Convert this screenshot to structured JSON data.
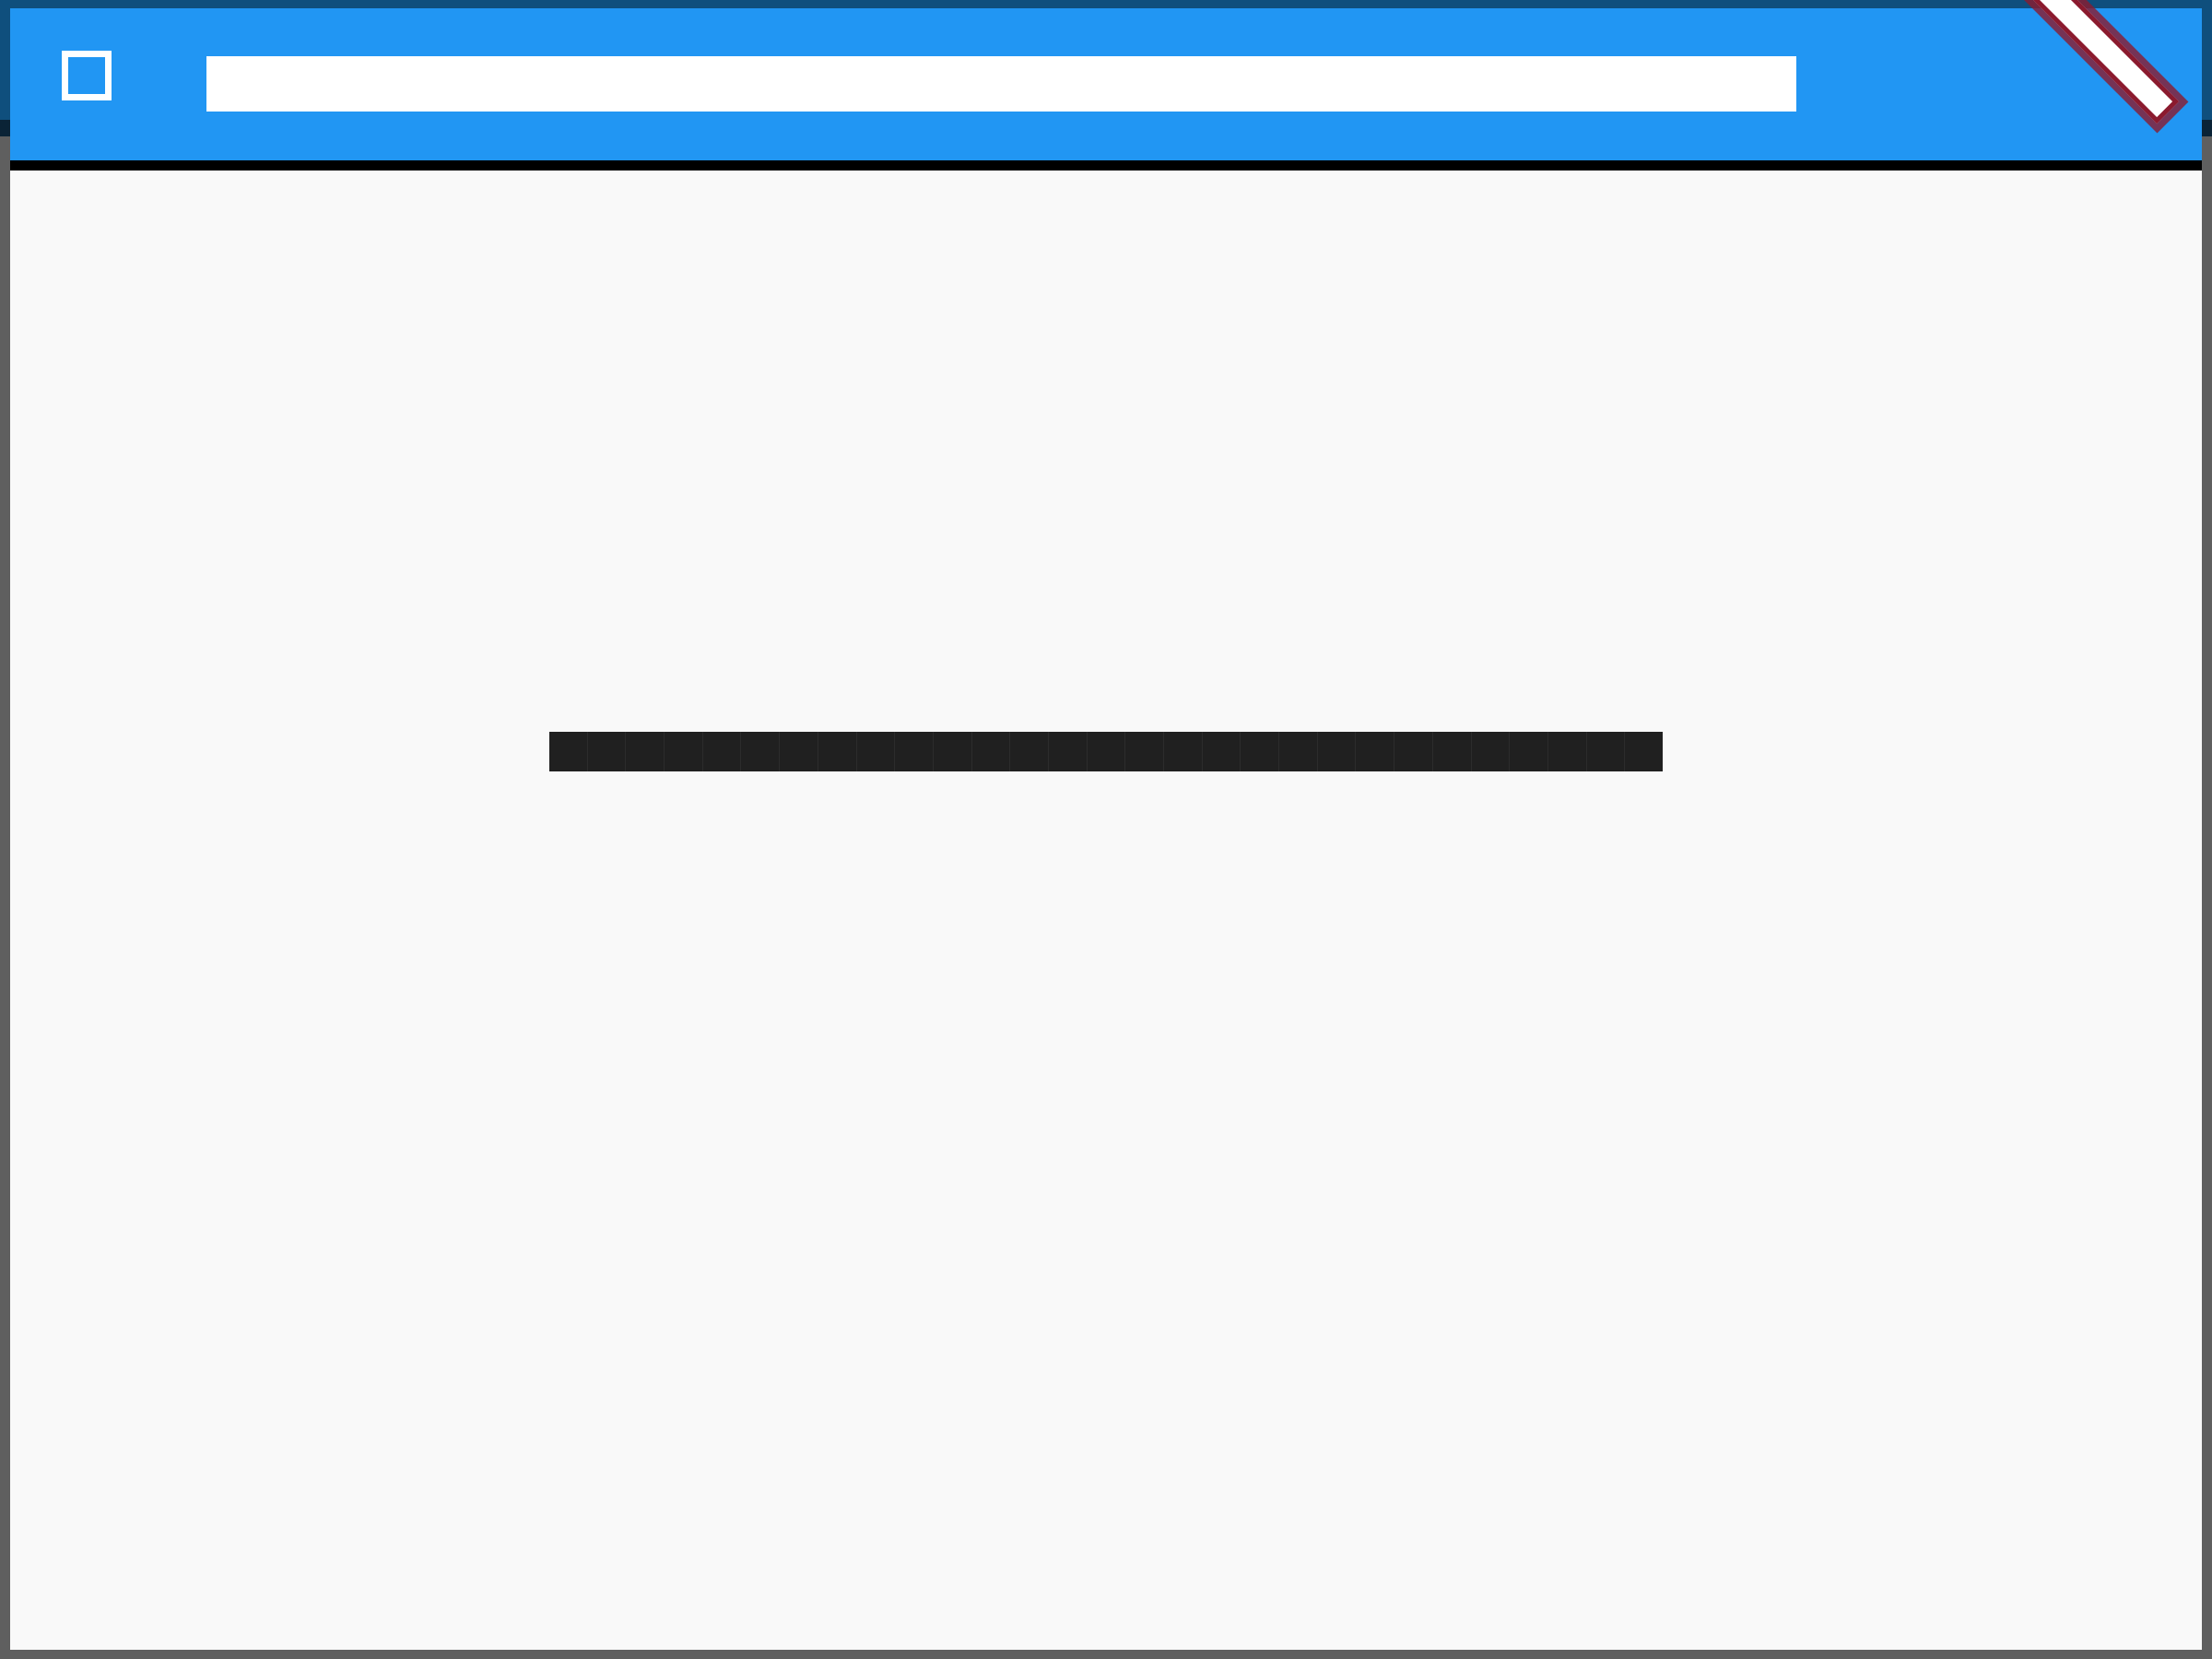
{
  "window": {
    "title": "",
    "app_icon": "square-outline-icon",
    "close_icon": "diagonal-bar-icon"
  },
  "content": {
    "loading_indicator": {
      "block_count": 29
    }
  },
  "colors": {
    "app_bar": "#2196f3",
    "content_background": "#f9f9f9",
    "loading_block": "#202020",
    "corner_accent": "#8b1a2e"
  }
}
